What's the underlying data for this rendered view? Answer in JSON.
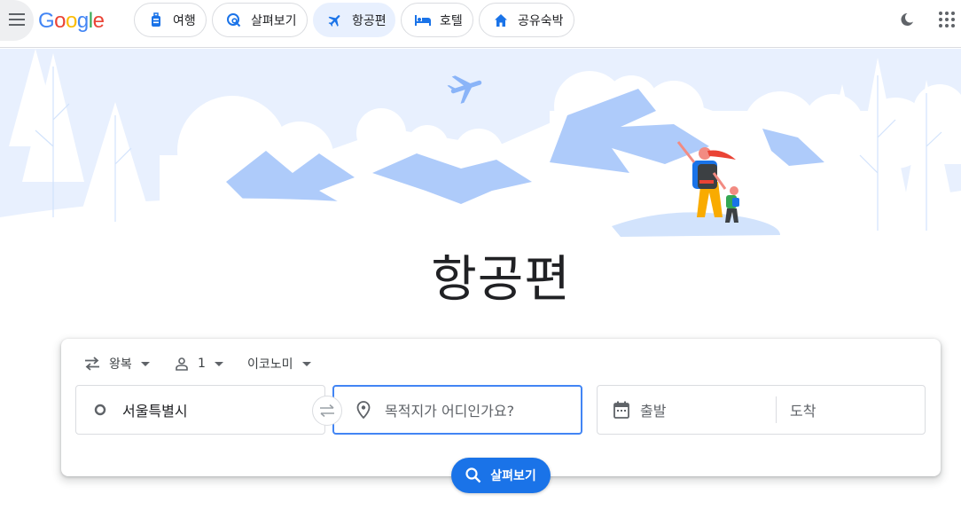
{
  "header": {
    "logo_letters": [
      {
        "ch": "G",
        "color": "#4285F4"
      },
      {
        "ch": "o",
        "color": "#EA4335"
      },
      {
        "ch": "o",
        "color": "#FBBC05"
      },
      {
        "ch": "g",
        "color": "#4285F4"
      },
      {
        "ch": "l",
        "color": "#34A853"
      },
      {
        "ch": "e",
        "color": "#EA4335"
      }
    ],
    "tabs": [
      {
        "label": "여행",
        "icon": "luggage-icon",
        "active": false
      },
      {
        "label": "살펴보기",
        "icon": "explore-icon",
        "active": false
      },
      {
        "label": "항공편",
        "icon": "flight-icon",
        "active": true
      },
      {
        "label": "호텔",
        "icon": "hotel-bed-icon",
        "active": false
      },
      {
        "label": "공유숙박",
        "icon": "home-icon",
        "active": false
      }
    ],
    "right_icons": [
      "dark-mode-icon",
      "apps-grid-icon"
    ],
    "accent_color": "#1A73E8"
  },
  "hero": {
    "title": "항공편"
  },
  "search": {
    "trip_type": "왕복",
    "passengers": "1",
    "cabin_class": "이코노미",
    "origin_value": "서울특별시",
    "destination_placeholder": "목적지가 어디인가요?",
    "depart_placeholder": "출발",
    "return_placeholder": "도착",
    "button_label": "살펴보기"
  }
}
